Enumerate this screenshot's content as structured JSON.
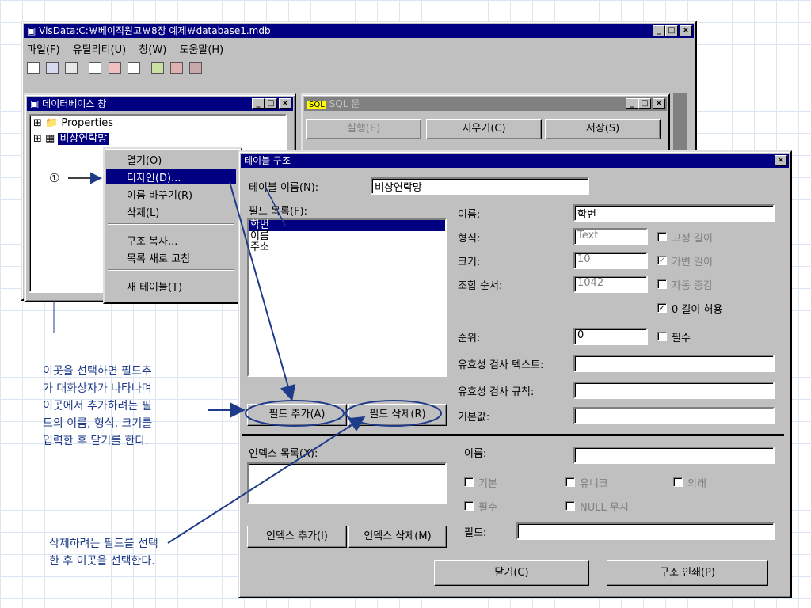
{
  "main_window": {
    "title": "VisData:C:￦베이직원고￦8장 예제￦database1.mdb",
    "menu": [
      "파일(F)",
      "유틸리티(U)",
      "창(W)",
      "도움말(H)"
    ]
  },
  "db_window": {
    "title": "데이터베이스 창",
    "tree": [
      "Properties",
      "비상연락망"
    ]
  },
  "sql_window": {
    "title": "SQL 문",
    "buttons": [
      "실행(E)",
      "지우기(C)",
      "저장(S)"
    ]
  },
  "context_menu": {
    "items": [
      "열기(O)",
      "디자인(D)...",
      "이름 바꾸기(R)",
      "삭제(L)",
      "구조 복사...",
      "목록 새로 고침",
      "새 테이블(T)"
    ]
  },
  "marker": "①",
  "table_dialog": {
    "title": "테이블 구조",
    "close": "×",
    "table_name_label": "테이블 이름(N):",
    "table_name_value": "비상연락망",
    "field_list_label": "필드 목록(F):",
    "fields": [
      "학번",
      "이름",
      "주소"
    ],
    "name_label": "이름:",
    "name_value": "학번",
    "type_label": "형식:",
    "type_value": "Text",
    "size_label": "크기:",
    "size_value": "10",
    "order_label": "조합 순서:",
    "order_value": "1042",
    "fixed_len": "고정 길이",
    "var_len": "가변 길이",
    "auto_inc": "자동 증감",
    "zero_len": "0 길이 허용",
    "ordinal_label": "순위:",
    "ordinal_value": "0",
    "required": "필수",
    "validation_text_label": "유효성 검사 텍스트:",
    "validation_rule_label": "유효성 검사 규칙:",
    "default_label": "기본값:",
    "add_field": "필드 추가(A)",
    "del_field": "필드 삭제(R)",
    "index_list_label": "인덱스 목록(X):",
    "index_name_label": "이름:",
    "primary": "기본",
    "unique": "유니크",
    "foreign": "외래",
    "idx_required": "필수",
    "ignore_null": "NULL 무시",
    "fields_label": "필드:",
    "add_index": "인덱스 추가(I)",
    "del_index": "인덱스 삭제(M)",
    "close_btn": "닫기(C)",
    "print_btn": "구조 인쇄(P)"
  },
  "annotations": {
    "note1": [
      "이곳을 선택하면 필드추",
      "가 대화상자가 나타나며",
      "이곳에서 추가하려는 필",
      "드의 이름, 형식, 크기를",
      "입력한 후 닫기를 한다."
    ],
    "note2": [
      "삭제하려는 필드를 선택",
      "한 후 이곳을 선택한다."
    ]
  }
}
